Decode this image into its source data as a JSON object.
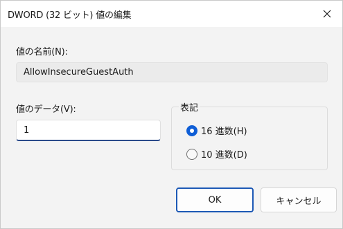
{
  "window": {
    "title": "DWORD (32 ビット) 値の編集",
    "close_icon": "close-icon"
  },
  "value_name": {
    "label": "値の名前(N):",
    "value": "AllowInsecureGuestAuth"
  },
  "value_data": {
    "label": "値のデータ(V):",
    "value": "1"
  },
  "radix": {
    "legend": "表記",
    "options": [
      {
        "label": "16 進数(H)",
        "selected": true
      },
      {
        "label": "10 進数(D)",
        "selected": false
      }
    ]
  },
  "buttons": {
    "ok": "OK",
    "cancel": "キャンセル"
  },
  "colors": {
    "accent": "#0f5ed6",
    "ok_border": "#1c58b5",
    "input_underline": "#2a4a8a"
  }
}
